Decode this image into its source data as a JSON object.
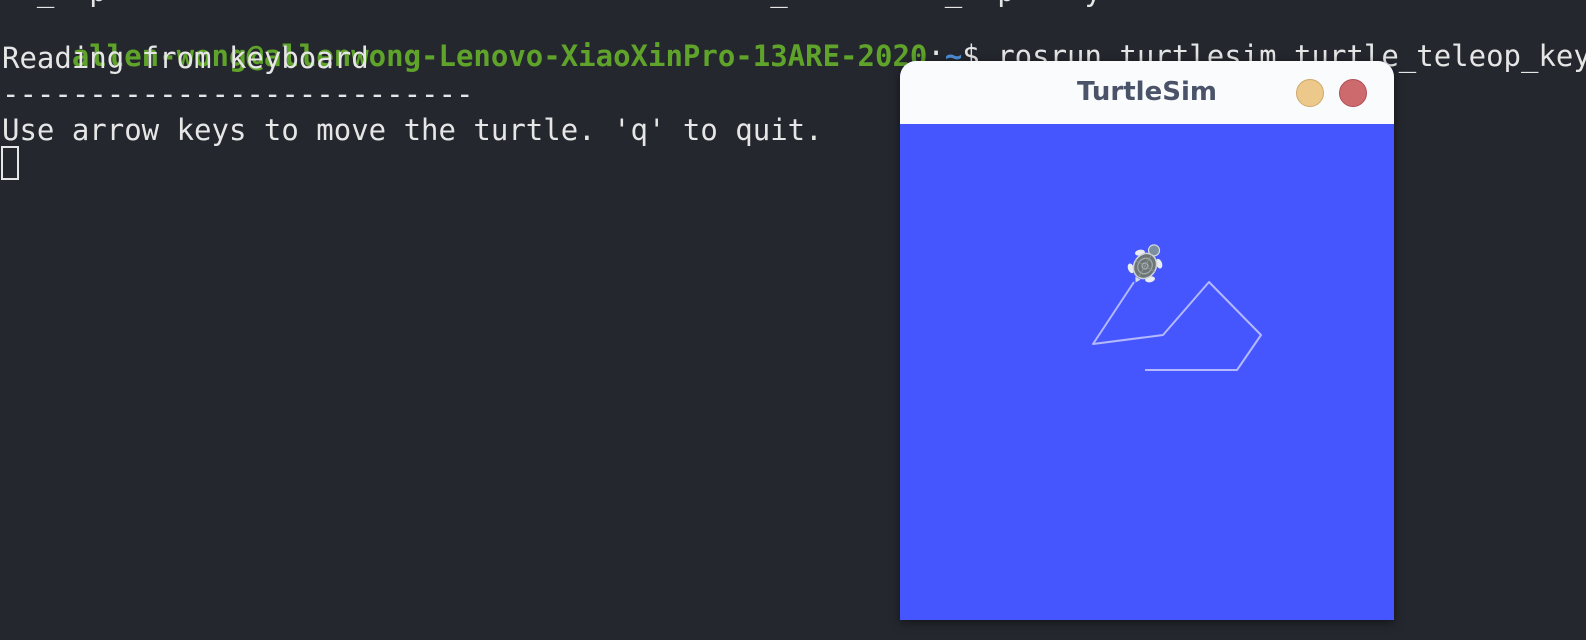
{
  "terminal": {
    "cutoff_previous_line": "  _  p                                      _         _  p    y",
    "prompt_user": "allen-wong@allenwong-Lenovo-XiaoXinPro-13ARE-2020",
    "prompt_sep": ":",
    "prompt_path": "~",
    "prompt_dollar": "$ ",
    "command": "rosrun turtlesim turtle_teleop_key",
    "output": [
      "Reading from keyboard",
      "---------------------------",
      "Use arrow keys to move the turtle. 'q' to quit."
    ]
  },
  "turtlesim": {
    "title": "TurtleSim",
    "background_color": "#4556fe",
    "pen_color": "#b3b8ff",
    "turtle_icon": "turtle-icon"
  }
}
